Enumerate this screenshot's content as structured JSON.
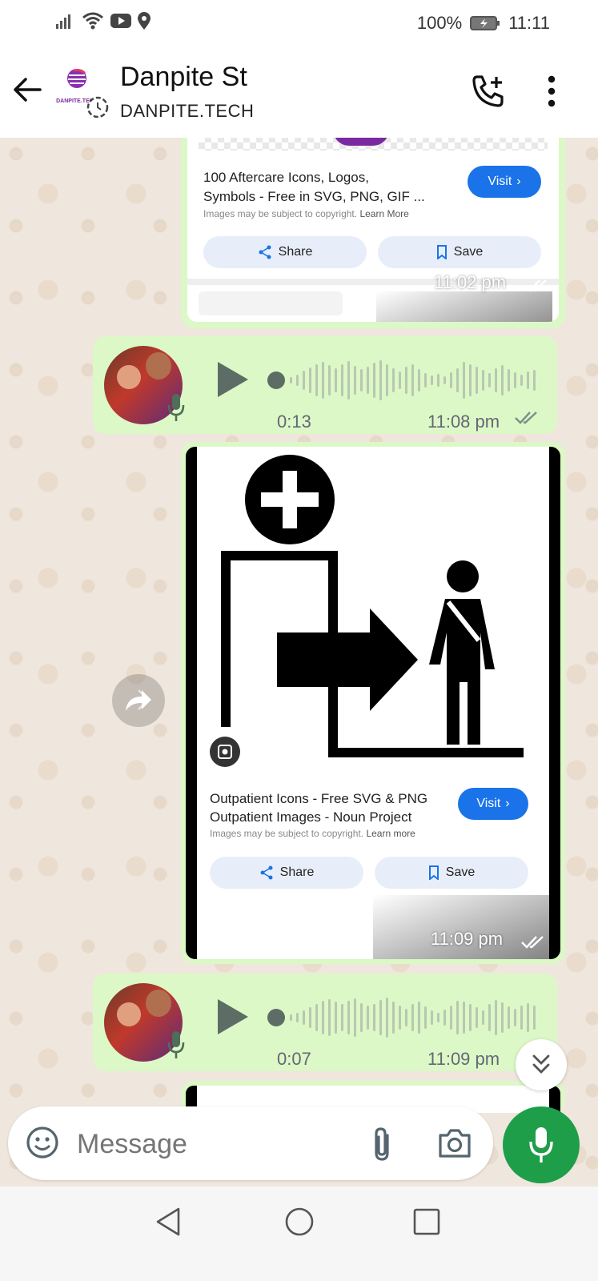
{
  "status_bar": {
    "battery": "100%",
    "time": "11:11"
  },
  "header": {
    "name": "Danpite St",
    "subtitle": "DANPITE.TECH",
    "logo_text": "DANPITE.TECH"
  },
  "messages": [
    {
      "type": "link_card",
      "title_line1": "100 Aftercare Icons, Logos,",
      "title_line2": "Symbols - Free in SVG, PNG, GIF ...",
      "note": "Images may be subject to copyright.",
      "note_link": "Learn More",
      "visit": "Visit",
      "share": "Share",
      "save": "Save",
      "time": "11:02 pm"
    },
    {
      "type": "voice",
      "duration": "0:13",
      "time": "11:08 pm"
    },
    {
      "type": "link_card",
      "title_line1": "Outpatient Icons - Free SVG & PNG",
      "title_line2": "Outpatient Images - Noun Project",
      "note": "Images may be subject to copyright.",
      "note_link": "Learn more",
      "visit": "Visit",
      "share": "Share",
      "save": "Save",
      "time": "11:09 pm"
    },
    {
      "type": "voice",
      "duration": "0:07",
      "time": "11:09 pm"
    }
  ],
  "input": {
    "placeholder": "Message"
  },
  "colors": {
    "bubble": "#dcf8c6",
    "accent_green": "#1f9e4a",
    "link_blue": "#1a73e8"
  }
}
